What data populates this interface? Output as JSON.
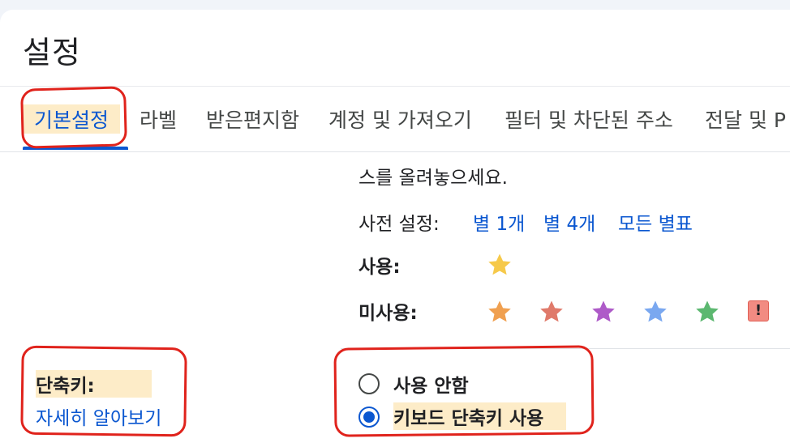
{
  "page": {
    "title": "설정"
  },
  "tabs": [
    {
      "label": "기본설정",
      "active": true
    },
    {
      "label": "라벨"
    },
    {
      "label": "받은편지함"
    },
    {
      "label": "계정 및 가져오기"
    },
    {
      "label": "필터 및 차단된 주소"
    },
    {
      "label": "전달 및 P"
    }
  ],
  "stars": {
    "description_tail": "스를 올려놓으세요.",
    "presets_label": "사전 설정:",
    "presets": [
      "별 1개",
      "별 4개",
      "모든 별표"
    ],
    "in_use_label": "사용:",
    "not_in_use_label": "미사용:",
    "in_use_colors": [
      "#f6c94a"
    ],
    "not_in_use_colors": [
      "#f0a050",
      "#e07a6b",
      "#ae5bc8",
      "#7aa8f0",
      "#5cb870"
    ],
    "badge_glyph": "!"
  },
  "shortcuts": {
    "label": "단축키:",
    "learn_more": "자세히 알아보기",
    "options": [
      {
        "label": "사용 안함",
        "selected": false
      },
      {
        "label": "키보드 단축키 사용",
        "selected": true
      }
    ]
  },
  "colors": {
    "accent": "#0b57d0",
    "annotation": "#e0231c",
    "highlight": "#fde9be"
  }
}
